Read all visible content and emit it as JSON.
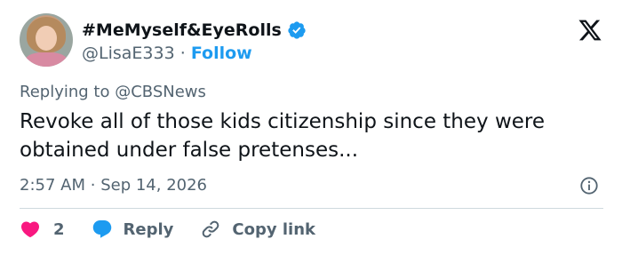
{
  "author": {
    "display_name": "#MeMyself&EyeRolls",
    "handle": "@LisaE333",
    "separator": "·",
    "follow_label": "Follow"
  },
  "reply_context": {
    "prefix": "Replying to",
    "mention": "@CBSNews"
  },
  "tweet": {
    "text": "Revoke all of those kids citizenship since they were obtained under false pretenses...",
    "time": "2:57 AM",
    "date": "Sep 14, 2026",
    "meta_separator": "·"
  },
  "actions": {
    "like_count": "2",
    "reply_label": "Reply",
    "copy_link_label": "Copy link"
  },
  "colors": {
    "accent": "#1d9bf0",
    "like": "#f91880",
    "text": "#0f1419",
    "muted": "#536471"
  },
  "icons": [
    "verified-badge-icon",
    "x-logo-icon",
    "info-icon",
    "heart-icon",
    "reply-bubble-icon",
    "link-icon"
  ]
}
